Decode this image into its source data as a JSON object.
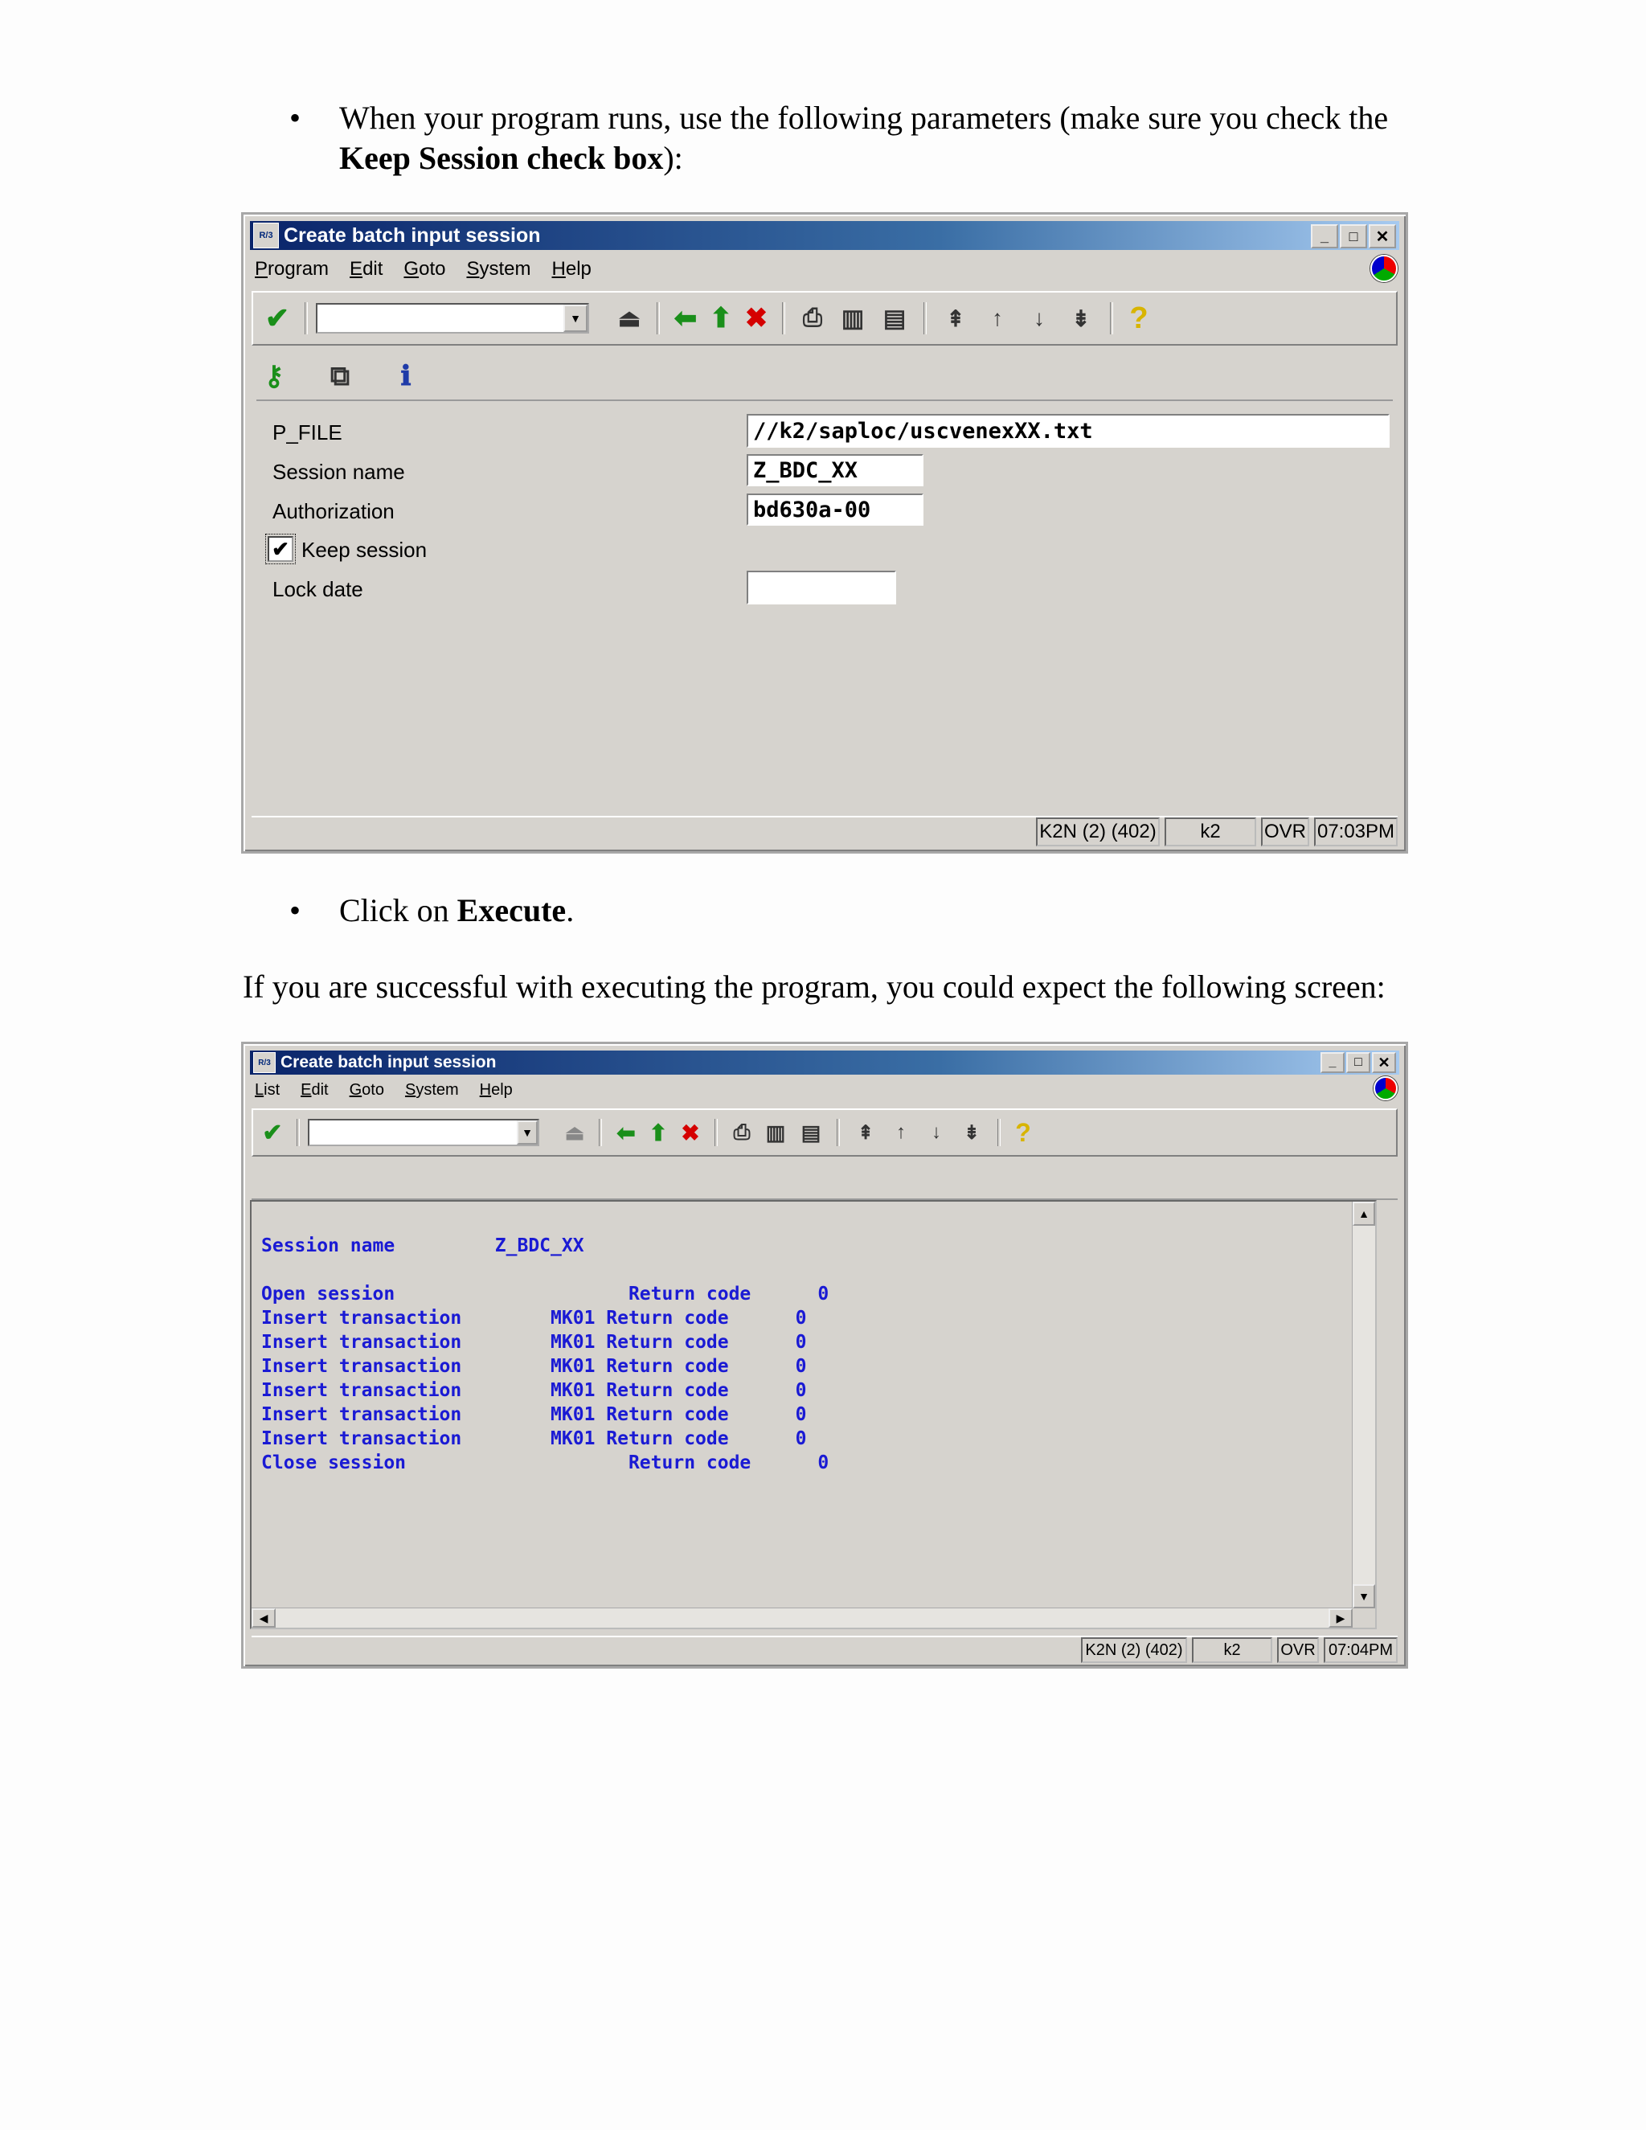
{
  "bullet1": {
    "text_a": "When your program runs, use the following parameters (make sure you check the",
    "text_b_bold": "Keep Session check box",
    "text_c": "):"
  },
  "window1": {
    "title": "Create batch input session",
    "sap_icon": "R/3",
    "menu": [
      "Program",
      "Edit",
      "Goto",
      "System",
      "Help"
    ],
    "toolbar_icons": [
      "enter-check-icon",
      "save-icon",
      "back-icon",
      "exit-icon",
      "cancel-icon",
      "print-icon",
      "find-icon",
      "find-next-icon",
      "first-page-icon",
      "prev-page-icon",
      "next-page-icon",
      "last-page-icon",
      "help-icon"
    ],
    "app_icons": [
      "execute-icon",
      "variants-icon",
      "info-icon"
    ],
    "fields": {
      "p_file_label": "P_FILE",
      "p_file_value": "//k2/saploc/uscvenexXX.txt",
      "session_label": "Session name",
      "session_value": "Z_BDC_XX",
      "auth_label": "Authorization",
      "auth_value": "bd630a-00",
      "keep_label": "Keep session",
      "keep_checked": "✔",
      "lock_label": "Lock date",
      "lock_value": ""
    },
    "status": [
      "K2N (2) (402)",
      "k2",
      "OVR",
      "07:03PM"
    ]
  },
  "bullet2": {
    "text_a": "Click on ",
    "text_b_bold": "Execute",
    "text_c": "."
  },
  "paragraph": "If you are successful with executing the program, you could expect the following screen:",
  "window2": {
    "title": "Create batch input session",
    "sap_icon": "R/3",
    "menu": [
      "List",
      "Edit",
      "Goto",
      "System",
      "Help"
    ],
    "list_lines": [
      "Session name         Z_BDC_XX",
      "",
      "Open session                     Return code      0",
      "Insert transaction        MK01 Return code      0",
      "Insert transaction        MK01 Return code      0",
      "Insert transaction        MK01 Return code      0",
      "Insert transaction        MK01 Return code      0",
      "Insert transaction        MK01 Return code      0",
      "Insert transaction        MK01 Return code      0",
      "Close session                    Return code      0"
    ],
    "status": [
      "K2N (2) (402)",
      "k2",
      "OVR",
      "07:04PM"
    ]
  }
}
